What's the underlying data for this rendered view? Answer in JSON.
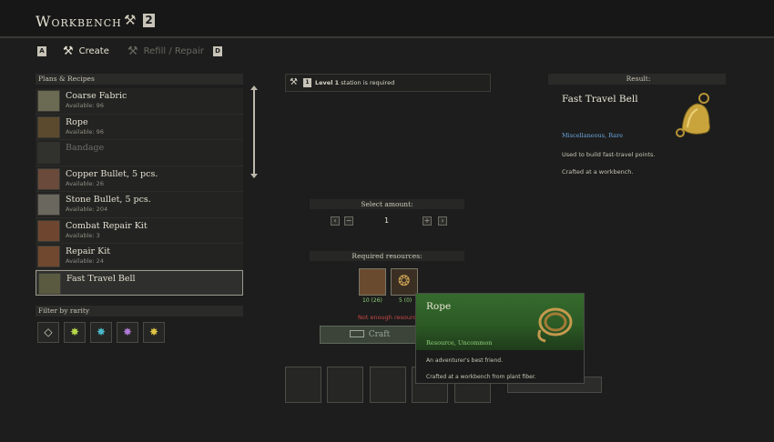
{
  "header": {
    "title": "Workbench",
    "badge": "2"
  },
  "tabs": {
    "prev_key": "A",
    "create_label": "Create",
    "refill_label": "Refill / Repair",
    "next_key": "D"
  },
  "plans": {
    "label": "Plans & Recipes",
    "items": [
      {
        "name": "Coarse Fabric",
        "available": "Available: 96"
      },
      {
        "name": "Rope",
        "available": "Available: 96"
      },
      {
        "name": "Bandage",
        "available": ""
      },
      {
        "name": "Copper Bullet, 5 pcs.",
        "available": "Available: 26"
      },
      {
        "name": "Stone Bullet, 5 pcs.",
        "available": "Available: 204"
      },
      {
        "name": "Combat Repair Kit",
        "available": "Available: 3"
      },
      {
        "name": "Repair Kit",
        "available": "Available: 24"
      },
      {
        "name": "Fast Travel Bell",
        "available": ""
      }
    ]
  },
  "filter": {
    "label": "Filter by rarity",
    "colors": [
      "#d9d4c6",
      "#b7d84a",
      "#4ab8c9",
      "#b07ad8",
      "#e0c244"
    ]
  },
  "requirement": {
    "key": "1",
    "level": "Level 1",
    "rest": " station is required"
  },
  "amount": {
    "label": "Select amount:",
    "value": "1"
  },
  "resources": {
    "label": "Required resources:",
    "slots": [
      {
        "count": "10 (26)",
        "color": "#8fd07a"
      },
      {
        "count": "5 (0)",
        "color": "#8fd07a"
      }
    ],
    "warning": "Not enough resource",
    "craft_label": "Craft"
  },
  "result": {
    "label": "Result:",
    "name": "Fast Travel Bell",
    "rarity": "Miscellaneous, Rare",
    "desc1": "Used to build fast-travel points.",
    "desc2": "Crafted at a workbench."
  },
  "tooltip": {
    "name": "Rope",
    "rarity": "Resource, Uncommon",
    "desc1": "An adventurer's best friend.",
    "desc2": "Crafted at a workbench from plant fiber."
  }
}
